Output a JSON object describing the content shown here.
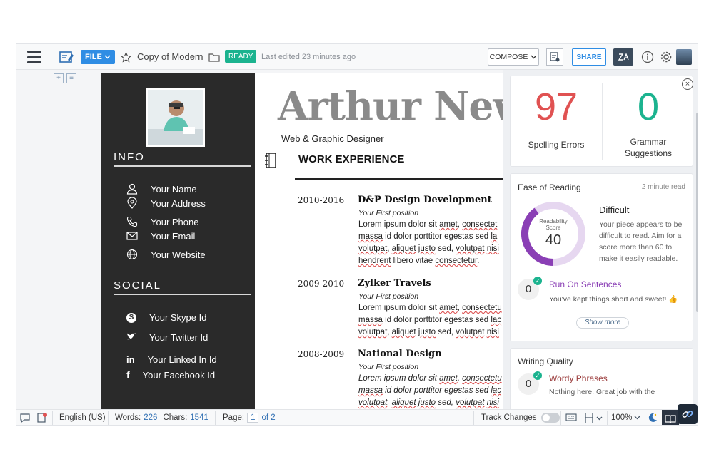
{
  "toolbar": {
    "file_label": "FILE",
    "doc_title": "Copy of Modern",
    "status": "READY",
    "last_edited": "Last edited 23 minutes ago",
    "compose_label": "COMPOSE",
    "share_label": "SHARE",
    "zia_label": "ZIA"
  },
  "resume": {
    "name": "Arthur New",
    "subtitle": "Web & Graphic Designer",
    "info_heading": "INFO",
    "info_items": [
      {
        "icon": "user-icon",
        "label": "Your Name"
      },
      {
        "icon": "location-icon",
        "label": "Your Address"
      },
      {
        "icon": "phone-icon",
        "label": "Your Phone"
      },
      {
        "icon": "email-icon",
        "label": "Your Email"
      },
      {
        "icon": "globe-icon",
        "label": "Your Website"
      }
    ],
    "social_heading": "SOCIAL",
    "social_items": [
      {
        "icon": "skype-icon",
        "label": "Your Skype Id"
      },
      {
        "icon": "twitter-icon",
        "label": "Your Twitter Id"
      },
      {
        "icon": "linkedin-icon",
        "label": "Your Linked In Id"
      },
      {
        "icon": "facebook-icon",
        "label": "Your Facebook Id"
      }
    ],
    "work_heading": "WORK EXPERIENCE",
    "jobs": [
      {
        "years": "2010-2016",
        "company": "D&P Design Development",
        "position": "Your First position",
        "l1a": "Lorem ipsum dolor sit ",
        "l1b": "amet",
        "l1c": ", ",
        "l1d": "consectet",
        "l2a": "massa",
        "l2b": " id dolor porttitor egestas sed ",
        "l2c": "la",
        "l3a": "volutpat",
        "l3b": ", ",
        "l3c": "aliquet",
        "l3d": " ",
        "l3e": "justo",
        "l3f": " sed, ",
        "l3g": "volutpat",
        "l3h": " ",
        "l3i": "nisi",
        "l4a": "hendrerit",
        "l4b": " libero vitae ",
        "l4c": "consectetur",
        "l4d": "."
      },
      {
        "years": "2009-2010",
        "company": "Zylker Travels",
        "position": "Your First position",
        "l1a": "Lorem ipsum dolor sit ",
        "l1b": "amet",
        "l1c": ", ",
        "l1d": "consectetu",
        "l2a": "massa",
        "l2b": " id dolor porttitor egestas sed ",
        "l2c": "lac",
        "l3a": "volutpat",
        "l3b": ", ",
        "l3c": "aliquet",
        "l3d": " ",
        "l3e": "justo",
        "l3f": " sed, ",
        "l3g": "volutpat",
        "l3h": " ",
        "l3i": "nisi"
      },
      {
        "years": "2008-2009",
        "company": "National Design",
        "position": "Your First position",
        "l1a": "Lorem ipsum dolor sit ",
        "l1b": "amet",
        "l1c": ", ",
        "l1d": "consectetu",
        "l2a": "massa",
        "l2b": " id dolor porttitor egestas sed ",
        "l2c": "lac",
        "l3a": "volutpat",
        "l3b": ", ",
        "l3c": "aliquet",
        "l3d": " ",
        "l3e": "justo",
        "l3f": " sed, ",
        "l3g": "volutpat",
        "l3h": " ",
        "l3i": "nisi"
      }
    ]
  },
  "zia": {
    "spelling_errors": "97",
    "spelling_label": "Spelling Errors",
    "grammar_count": "0",
    "grammar_label_1": "Grammar",
    "grammar_label_2": "Suggestions",
    "ease_title": "Ease of Reading",
    "read_time": "2 minute read",
    "readability_label_1": "Readability",
    "readability_label_2": "Score",
    "readability_score": "40",
    "readability_fraction": 0.4,
    "difficulty": "Difficult",
    "difficulty_desc": "Your piece appears to be difficult to read. Aim for a score more than 60 to make it easily readable.",
    "run_on_count": "0",
    "run_on_title": "Run On Sentences",
    "run_on_desc": "You've kept things short and sweet! 👍",
    "show_more": "Show more",
    "writing_title": "Writing Quality",
    "wordy_count": "0",
    "wordy_title": "Wordy Phrases",
    "wordy_desc": "Nothing here. Great job with the",
    "colors": {
      "spelling": "#e05252",
      "grammar": "#1bb38f",
      "gauge": "#8a3fb5"
    }
  },
  "status": {
    "language": "English (US)",
    "words_label": "Words:",
    "words": "226",
    "chars_label": "Chars:",
    "chars": "1541",
    "page_label": "Page:",
    "page_current": "1",
    "page_total": "of 2",
    "track_changes": "Track Changes",
    "zoom": "100%"
  }
}
